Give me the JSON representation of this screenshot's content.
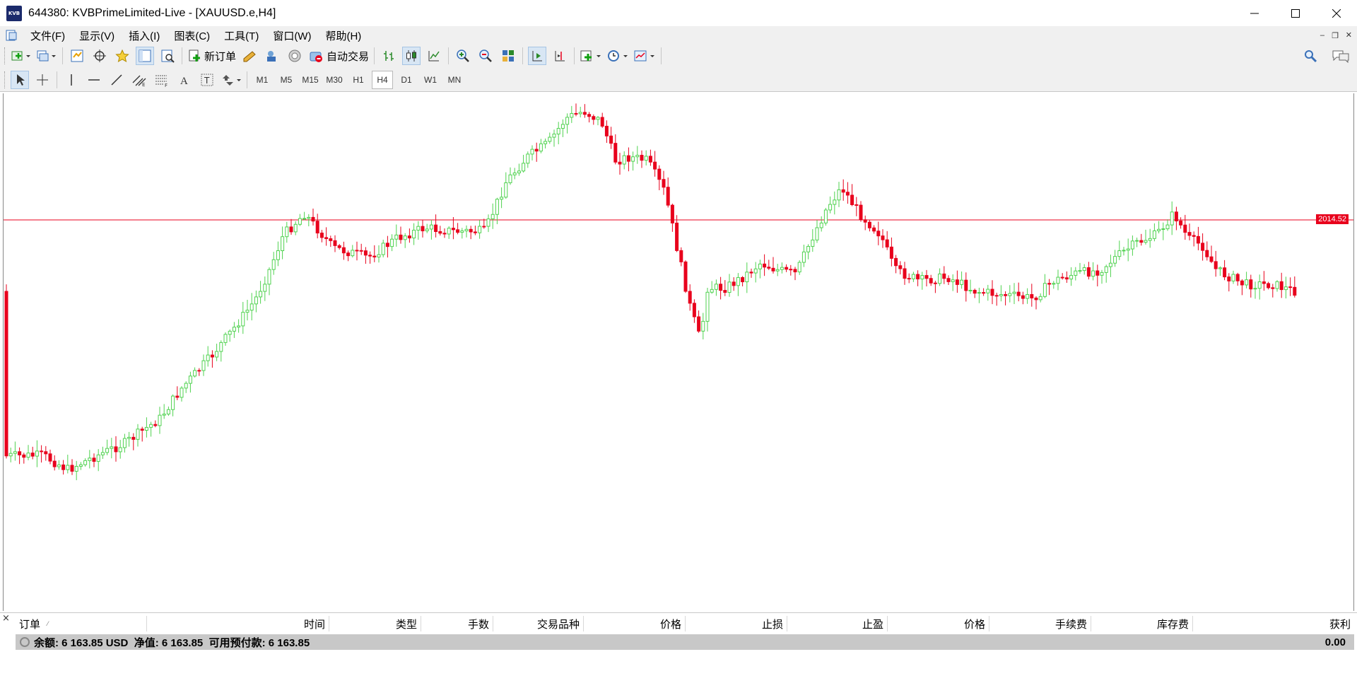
{
  "window": {
    "title": "644380: KVBPrimeLimited-Live - [XAUUSD.e,H4]",
    "app_icon_text": "KVB"
  },
  "menu": {
    "items": [
      "文件(F)",
      "显示(V)",
      "插入(I)",
      "图表(C)",
      "工具(T)",
      "窗口(W)",
      "帮助(H)"
    ]
  },
  "toolbar": {
    "new_order_label": "新订单",
    "auto_trade_label": "自动交易",
    "timeframes": [
      "M1",
      "M5",
      "M15",
      "M30",
      "H1",
      "H4",
      "D1",
      "W1",
      "MN"
    ],
    "selected_timeframe": "H4"
  },
  "chart": {
    "symbol": "XAUUSD.e",
    "period": "H4",
    "price_line_label": "2014.52",
    "price_line_color": "#e8001c",
    "bull_color": "#4fd24f",
    "bear_color": "#e8001c"
  },
  "terminal": {
    "close_icon": "×",
    "columns": [
      "订单",
      "时间",
      "类型",
      "手数",
      "交易品种",
      "价格",
      "止损",
      "止盈",
      "价格",
      "手续费",
      "库存费",
      "获利"
    ],
    "balance_text": "余额: 6 163.85 USD  净值: 6 163.85  可用预付款: 6 163.85",
    "profit": "0.00"
  }
}
